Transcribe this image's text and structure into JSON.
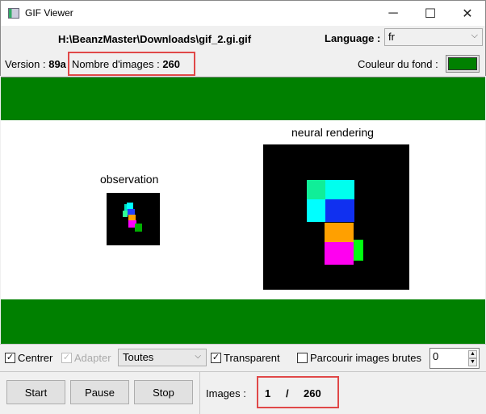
{
  "window": {
    "title": "GIF Viewer",
    "minimize": "─",
    "maximize": "☐",
    "close": "✕"
  },
  "header": {
    "file_path": "H:\\BeanzMaster\\Downloads\\gif_2.gi.gif",
    "language_label": "Language :",
    "language_value": "fr",
    "version_label": "Version :",
    "version_value": "89a",
    "frames_label": "Nombre d'images :",
    "frames_value": "260",
    "bg_color_label": "Couleur du fond :",
    "bg_color": "#008000"
  },
  "canvas": {
    "left_caption": "observation",
    "right_caption": "neural rendering",
    "band_color": "#008000"
  },
  "controls": {
    "center_label": "Centrer",
    "center_checked": true,
    "fit_label": "Adapter",
    "fit_checked": true,
    "fit_disabled": true,
    "mode_value": "Toutes",
    "transparent_label": "Transparent",
    "transparent_checked": true,
    "raw_label": "Parcourir images brutes",
    "raw_checked": false,
    "spin_value": "0"
  },
  "playback": {
    "start": "Start",
    "pause": "Pause",
    "stop": "Stop",
    "images_label": "Images :",
    "current": "1",
    "separator": "/",
    "total": "260"
  }
}
